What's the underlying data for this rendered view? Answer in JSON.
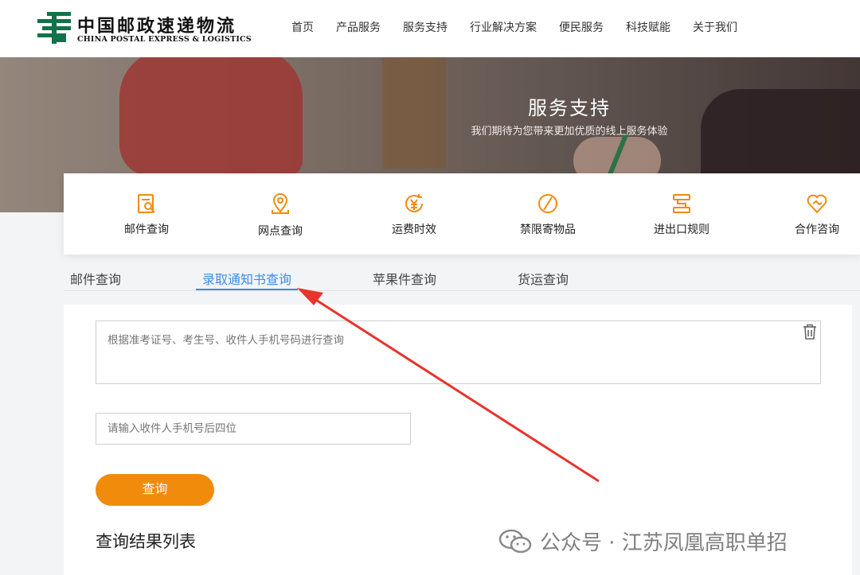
{
  "header": {
    "logo_cn": "中国邮政速递物流",
    "logo_en": "CHINA POSTAL EXPRESS & LOGISTICS",
    "nav": [
      "首页",
      "产品服务",
      "服务支持",
      "行业解决方案",
      "便民服务",
      "科技赋能",
      "关于我们"
    ]
  },
  "banner": {
    "title": "服务支持",
    "subtitle": "我们期待为您带来更加优质的线上服务体验"
  },
  "services": [
    {
      "label": "邮件查询",
      "icon": "mail-search-icon"
    },
    {
      "label": "网点查询",
      "icon": "location-pin-icon"
    },
    {
      "label": "运费时效",
      "icon": "yen-clock-icon"
    },
    {
      "label": "禁限寄物品",
      "icon": "prohibited-icon"
    },
    {
      "label": "进出口规则",
      "icon": "import-export-icon"
    },
    {
      "label": "合作咨询",
      "icon": "handshake-heart-icon"
    }
  ],
  "tabs": [
    "邮件查询",
    "录取通知书查询",
    "苹果件查询",
    "货运查询"
  ],
  "active_tab": "录取通知书查询",
  "form": {
    "query_placeholder": "根据准考证号、考生号、收件人手机号码进行查询",
    "phone_placeholder": "请输入收件人手机号后四位",
    "submit_label": "查询",
    "result_title": "查询结果列表"
  },
  "watermark": {
    "text": "公众号 · 江苏凤凰高职单招",
    "icon": "wechat-icon"
  },
  "colors": {
    "brand_green": "#12724a",
    "accent_orange": "#f08b0c",
    "tab_blue": "#3b8ee8",
    "annotation_red": "#e8342c"
  }
}
